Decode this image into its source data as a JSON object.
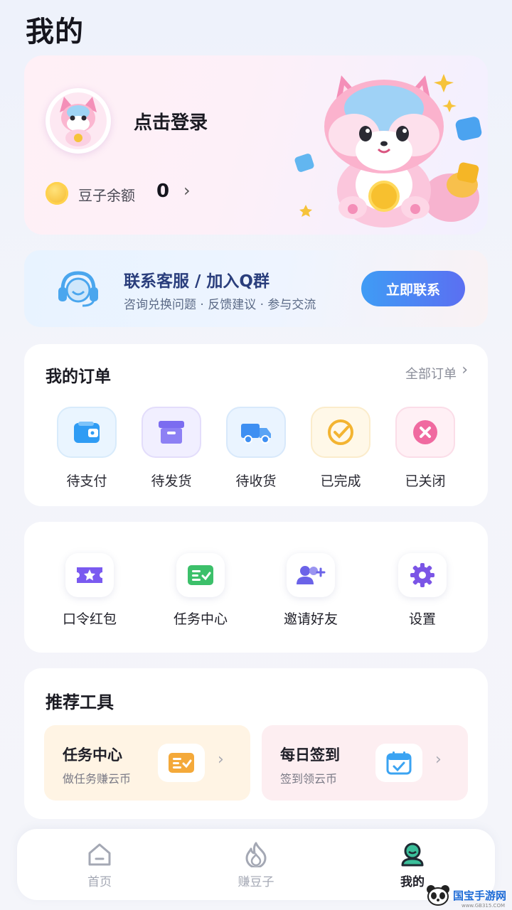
{
  "page": {
    "title": "我的"
  },
  "profile": {
    "login_text": "点击登录",
    "balance_label": "豆子余额",
    "balance_value": "0",
    "chevron": "›"
  },
  "service": {
    "title": "联系客服 / 加入Q群",
    "subtitle": "咨询兑换问题 · 反馈建议 · 参与交流",
    "button_label": "立即联系"
  },
  "orders": {
    "title": "我的订单",
    "all_label": "全部订单",
    "items": [
      {
        "label": "待支付",
        "icon": "wallet-icon",
        "color": "#2f9cf4"
      },
      {
        "label": "待发货",
        "icon": "box-icon",
        "color": "#7b6cf0"
      },
      {
        "label": "待收货",
        "icon": "truck-icon",
        "color": "#3e8ff2"
      },
      {
        "label": "已完成",
        "icon": "check-circle-icon",
        "color": "#f3b431"
      },
      {
        "label": "已关闭",
        "icon": "close-circle-icon",
        "color": "#f06aa0"
      }
    ]
  },
  "tools": {
    "items": [
      {
        "label": "口令红包",
        "icon": "ticket-star-icon",
        "color": "#7a5af0"
      },
      {
        "label": "任务中心",
        "icon": "task-list-icon",
        "color": "#3cc06a"
      },
      {
        "label": "邀请好友",
        "icon": "add-user-icon",
        "color": "#6b63e8"
      },
      {
        "label": "设置",
        "icon": "gear-icon",
        "color": "#7b55e6"
      }
    ]
  },
  "recommended": {
    "title": "推荐工具",
    "tiles": [
      {
        "title": "任务中心",
        "subtitle": "做任务赚云币",
        "icon": "task-list-icon",
        "color": "#f4a93a"
      },
      {
        "title": "每日签到",
        "subtitle": "签到领云币",
        "icon": "calendar-check-icon",
        "color": "#3aa3f2"
      }
    ]
  },
  "tabbar": {
    "tabs": [
      {
        "label": "首页",
        "icon": "home-icon",
        "active": false
      },
      {
        "label": "赚豆子",
        "icon": "flame-icon",
        "active": false
      },
      {
        "label": "我的",
        "icon": "profile-icon",
        "active": true
      }
    ]
  },
  "watermark": {
    "text": "国宝手游网",
    "domain": "www.GB315.COM"
  }
}
